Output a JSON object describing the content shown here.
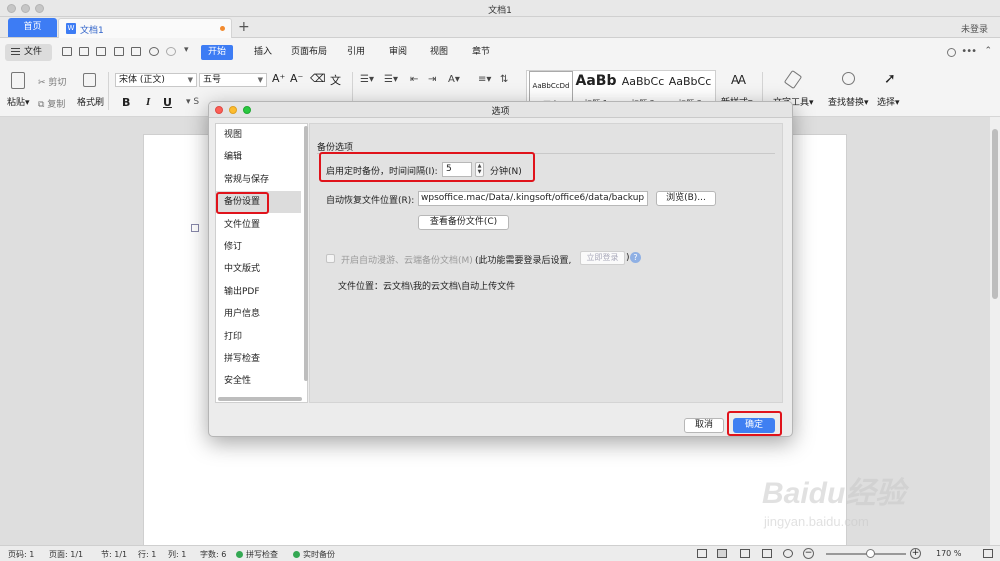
{
  "window": {
    "title": "文档1"
  },
  "tabs": {
    "home": "首页",
    "doc": "文档1",
    "add": "+",
    "login": "未登录"
  },
  "menu": {
    "file": "文件",
    "items": [
      "开始",
      "插入",
      "页面布局",
      "引用",
      "审阅",
      "视图",
      "章节"
    ],
    "active": "开始"
  },
  "ribbon": {
    "paste": "粘贴",
    "cut": "剪切",
    "copy": "复制",
    "format_painter": "格式刷",
    "font_name": "宋体 (正文)",
    "font_size": "五号",
    "bold": "B",
    "italic": "I",
    "underline": "U",
    "styles": [
      {
        "sample": "AaBbCcDd",
        "name": "正文"
      },
      {
        "sample": "AaBb",
        "name": "标题 1"
      },
      {
        "sample": "AaBbCc",
        "name": "标题 2"
      },
      {
        "sample": "AaBbCc",
        "name": "标题 3"
      }
    ],
    "new_style": "新样式",
    "text_tools": "文字工具",
    "find_replace": "查找替换",
    "select": "选择"
  },
  "dialog": {
    "title": "选项",
    "nav": [
      "视图",
      "编辑",
      "常规与保存",
      "备份设置",
      "文件位置",
      "修订",
      "中文版式",
      "输出PDF",
      "用户信息",
      "打印",
      "拼写检查",
      "安全性"
    ],
    "selected_nav": "备份设置",
    "section_title": "备份选项",
    "timed_backup_label": "启用定时备份，时间间隔(I):",
    "interval_value": "5",
    "minutes_label": "分钟(N)",
    "autorecover_label": "自动恢复文件位置(R):",
    "autorecover_path": "wpsoffice.mac/Data/.kingsoft/office6/data/backup",
    "browse_button": "浏览(B)...",
    "view_backup_button": "查看备份文件(C)",
    "cloud_roaming_label": "开启自动漫游、云端备份文档(M)",
    "cloud_note": "(此功能需要登录后设置,",
    "login_now_button": "立即登录",
    "cloud_note_close": ")",
    "help": "?",
    "file_location": "文件位置：云文档\\我的云文档\\自动上传文件",
    "cancel_button": "取消",
    "ok_button": "确定"
  },
  "statusbar": {
    "page_num": "页码: 1",
    "pages": "页面: 1/1",
    "section": "节: 1/1",
    "row": "行: 1",
    "col": "列: 1",
    "word_count": "字数: 6",
    "spell_check": "拼写检查",
    "live_backup": "实时备份",
    "zoom": "170 %"
  },
  "watermark": {
    "text": "Baidu经验",
    "url": "jingyan.baidu.com"
  },
  "colors": {
    "accent": "#3d7cf4",
    "highlight": "#e0131b"
  }
}
